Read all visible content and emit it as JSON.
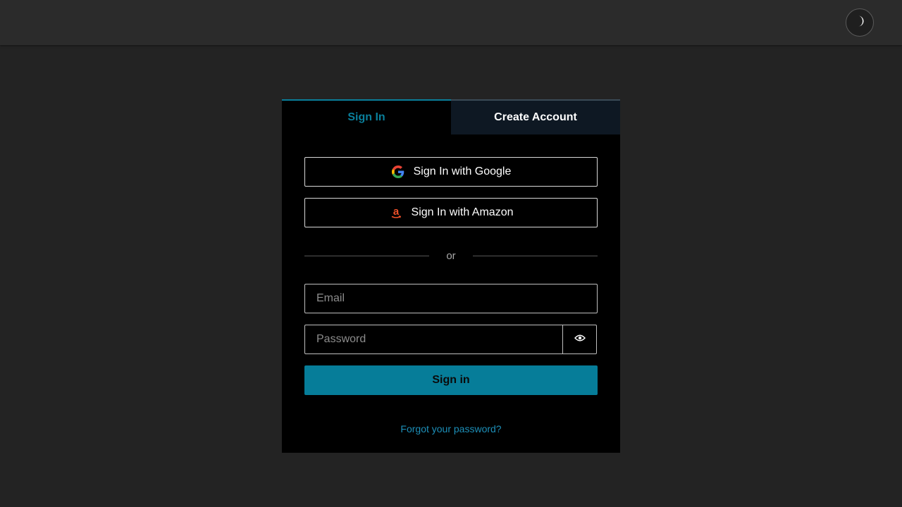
{
  "header": {
    "theme_toggle_icon": "moon-icon"
  },
  "tabs": [
    {
      "label": "Sign In",
      "active": true
    },
    {
      "label": "Create Account",
      "active": false
    }
  ],
  "federated": {
    "google_label": "Sign In with Google",
    "google_icon": "google-icon",
    "amazon_label": "Sign In with Amazon",
    "amazon_icon": "amazon-icon"
  },
  "divider": {
    "text": "or"
  },
  "form": {
    "email_placeholder": "Email",
    "email_value": "",
    "password_placeholder": "Password",
    "password_value": "",
    "show_password_icon": "eye-icon",
    "submit_label": "Sign in",
    "forgot_label": "Forgot your password?"
  },
  "colors": {
    "accent": "#067d99",
    "link": "#1d8fb8",
    "page_background": "#232323",
    "card_background": "#000000",
    "inactive_tab_background": "#0e1823"
  }
}
